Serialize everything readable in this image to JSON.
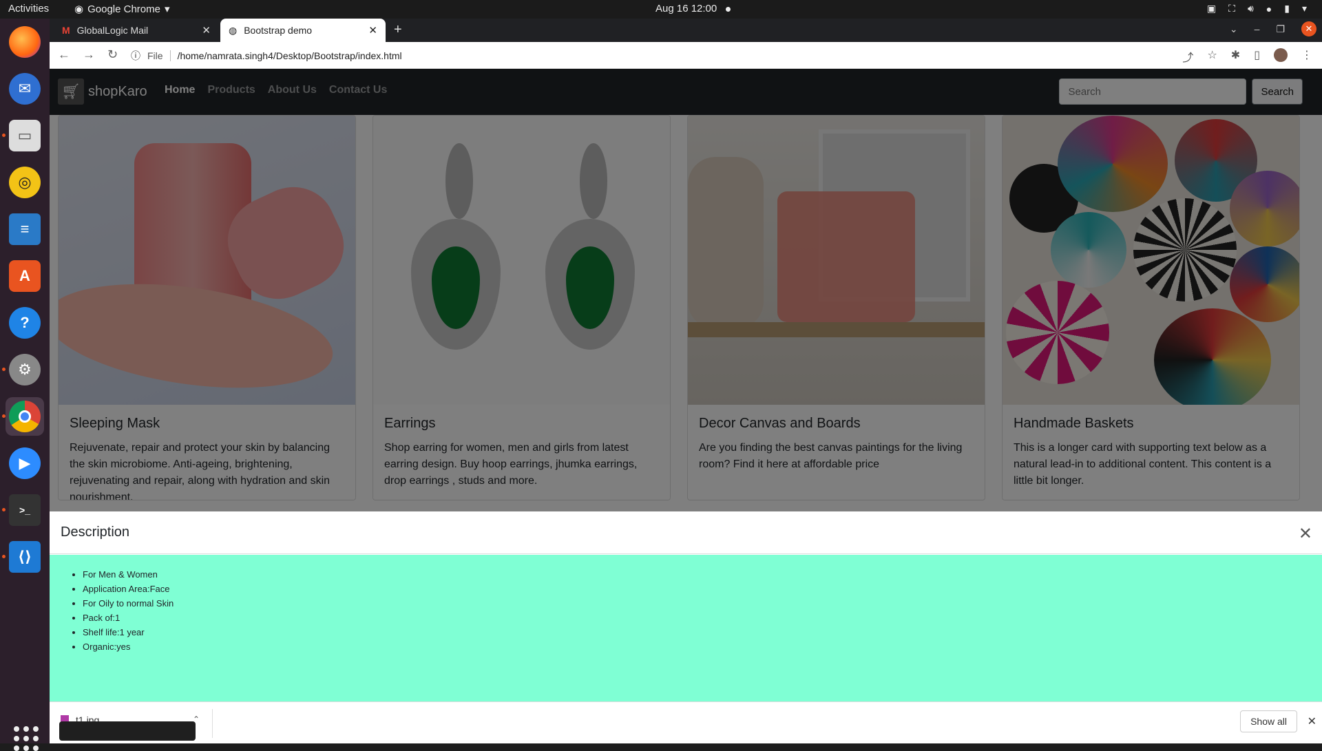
{
  "system": {
    "activities": "Activities",
    "app_menu": "Google Chrome",
    "clock": "Aug 16  12:00"
  },
  "browser": {
    "tabs": [
      {
        "label": "GlobalLogic Mail",
        "icon": "gmail-icon"
      },
      {
        "label": "Bootstrap demo",
        "icon": "globe-icon"
      }
    ],
    "url_scheme_label": "File",
    "url": "/home/namrata.singh4/Desktop/Bootstrap/index.html"
  },
  "site": {
    "brand": "shopKaro",
    "nav": [
      "Home",
      "Products",
      "About Us",
      "Contact Us"
    ],
    "search_placeholder": "Search",
    "search_button": "Search"
  },
  "cards": [
    {
      "title": "Sleeping Mask",
      "text": "Rejuvenate, repair and protect your skin by balancing the skin microbiome. Anti-ageing, brightening, rejuvenating and repair, along with hydration and skin nourishment."
    },
    {
      "title": "Earrings",
      "text": "Shop earring for women, men and girls from latest earring design. Buy hoop earrings, jhumka earrings, drop earrings , studs and more."
    },
    {
      "title": "Decor Canvas and Boards",
      "text": "Are you finding the best canvas paintings for the living room? Find it here at affordable price"
    },
    {
      "title": "Handmade Baskets",
      "text": "This is a longer card with supporting text below as a natural lead-in to additional content. This content is a little bit longer."
    }
  ],
  "modal": {
    "title": "Description",
    "items": [
      "For Men & Women",
      "Application Area:Face",
      "For Oily to normal Skin",
      "Pack of:1",
      "Shelf life:1 year",
      "Organic:yes"
    ],
    "body_color": "#7fffd4"
  },
  "downloads": {
    "file": "t1.jpg",
    "show_all": "Show all"
  },
  "colors": {
    "navbar": "#212529",
    "accent": "#e95420"
  }
}
